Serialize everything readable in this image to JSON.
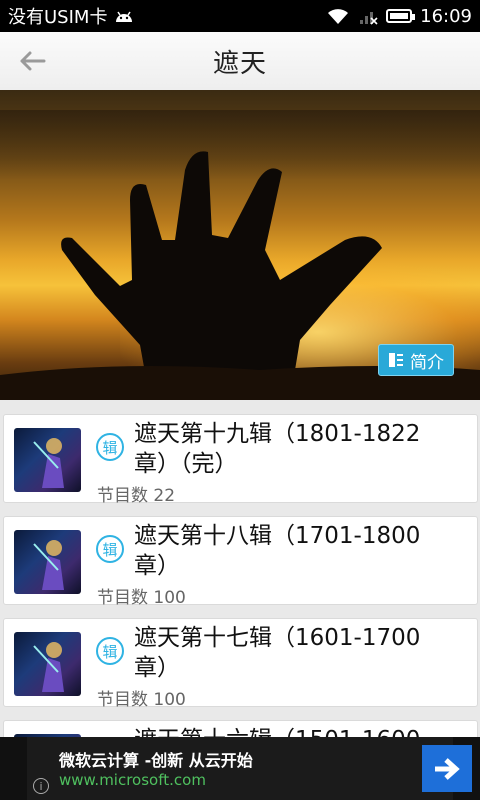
{
  "status_bar": {
    "carrier": "没有USIM卡",
    "time": "16:09",
    "icons": [
      "android-icon",
      "wifi-icon",
      "signal-icon",
      "battery-icon"
    ]
  },
  "header": {
    "title": "遮天",
    "back_icon": "back-arrow-icon"
  },
  "banner": {
    "intro_label": "简介",
    "intro_icon": "list-icon"
  },
  "episodes": [
    {
      "badge": "辑",
      "title": "遮天第十九辑（1801-1822章）（完）",
      "count": "节目数 22"
    },
    {
      "badge": "辑",
      "title": "遮天第十八辑（1701-1800章）",
      "count": "节目数 100"
    },
    {
      "badge": "辑",
      "title": "遮天第十七辑（1601-1700章）",
      "count": "节目数 100"
    },
    {
      "badge": "辑",
      "title": "遮天第十六辑（1501-1600",
      "count": ""
    }
  ],
  "ad": {
    "title": "微软云计算 -创新 从云开始",
    "url": "www.microsoft.com",
    "arrow_icon": "arrow-right-icon",
    "info_icon": "info-icon"
  },
  "colors": {
    "accent": "#2fb3e3",
    "intro_button": "#29a9d8",
    "ad_button": "#1e6fd9",
    "ad_url": "#4fc05f"
  }
}
